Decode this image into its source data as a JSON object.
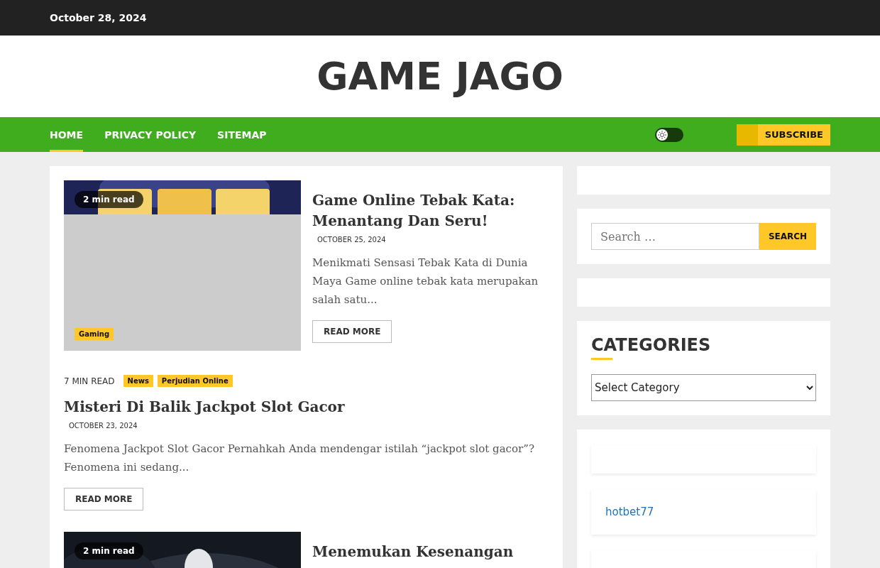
{
  "top_bar": {
    "date": "October 28, 2024"
  },
  "site_title": "GAME JAGO",
  "nav": {
    "items": [
      {
        "label": "HOME",
        "selected": true
      },
      {
        "label": "PRIVACY POLICY",
        "selected": false
      },
      {
        "label": "SITEMAP",
        "selected": false
      }
    ],
    "dark_mode": false,
    "subscribe": "SUBSCRIBE"
  },
  "articles": [
    {
      "kind": "card",
      "read_time": "2 min read",
      "categories": [
        "Gaming"
      ],
      "title": "Game Online Tebak Kata: Menantang Dan Seru!",
      "date": "OCTOBER 25, 2024",
      "excerpt": "Menikmati Sensasi Tebak Kata di Dunia Maya Game online tebak kata merupakan salah satu...",
      "button": "READ MORE"
    },
    {
      "kind": "text",
      "read_time": "7 MIN READ",
      "categories": [
        "News",
        "Perjudian Online"
      ],
      "title": "Misteri Di Balik Jackpot Slot Gacor",
      "date": "OCTOBER 23, 2024",
      "excerpt": "Fenomena Jackpot Slot Gacor Pernahkah Anda mendengar istilah “jackpot slot gacor”? Fenomena ini sedang...",
      "button": "READ MORE"
    },
    {
      "kind": "card",
      "read_time": "2 min read",
      "title": "Menemukan Kesenangan"
    }
  ],
  "sidebar": {
    "search": {
      "placeholder": "Search …",
      "button": "SEARCH"
    },
    "categories": {
      "title": "CATEGORIES",
      "select": "Select Category"
    },
    "links": [
      "hotbet77"
    ]
  }
}
